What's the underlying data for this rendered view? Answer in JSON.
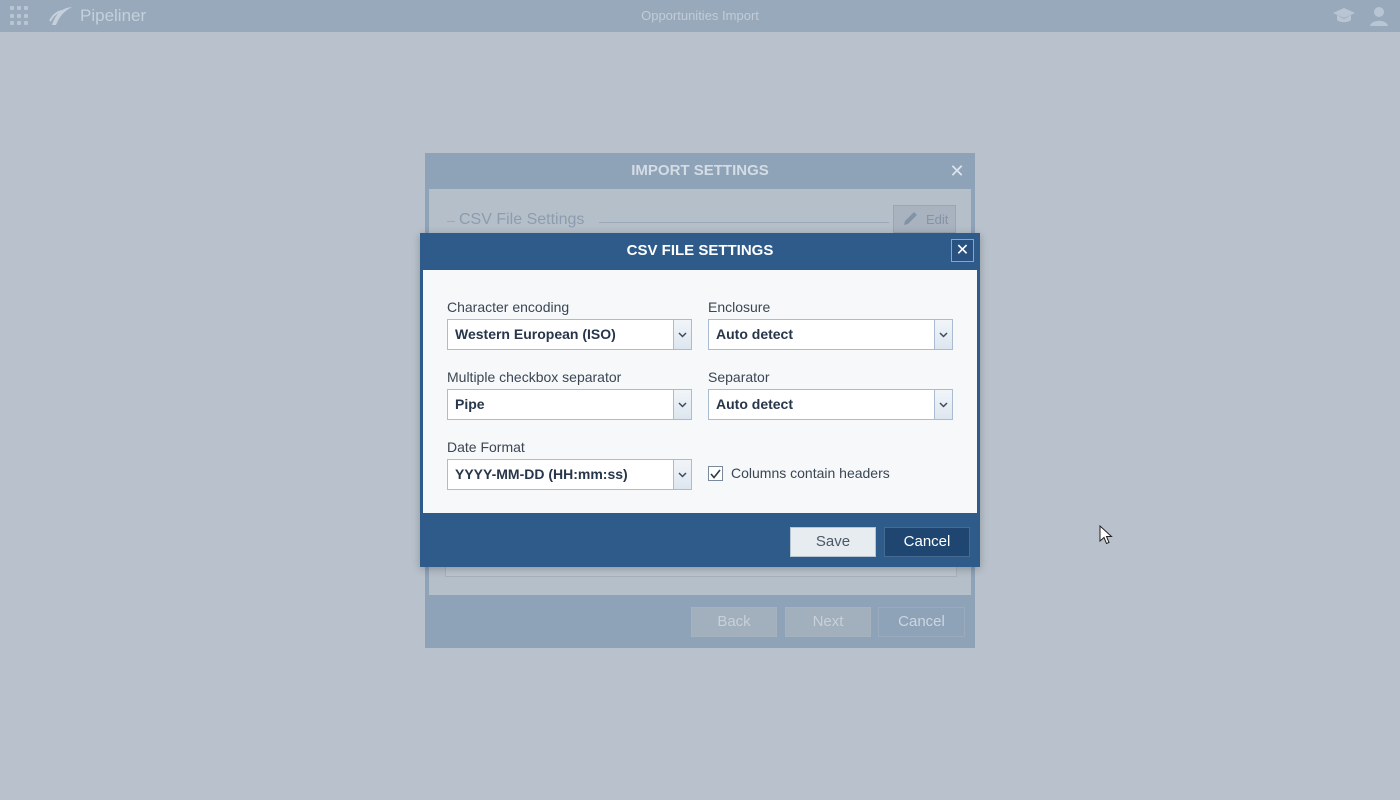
{
  "topbar": {
    "brand": "Pipeliner",
    "title": "Opportunities Import"
  },
  "background_dialog": {
    "title": "IMPORT SETTINGS",
    "close_glyph": "✕",
    "section_title": "CSV File Settings",
    "edit_label": "Edit",
    "buttons": {
      "back": "Back",
      "next": "Next",
      "cancel": "Cancel"
    }
  },
  "csv_dialog": {
    "title": "CSV FILE SETTINGS",
    "close_glyph": "✕",
    "fields": {
      "character_encoding": {
        "label": "Character encoding",
        "value": "Western European (ISO)"
      },
      "enclosure": {
        "label": "Enclosure",
        "value": "Auto detect"
      },
      "multiple_checkbox_separator": {
        "label": "Multiple checkbox separator",
        "value": "Pipe"
      },
      "separator": {
        "label": "Separator",
        "value": "Auto detect"
      },
      "date_format": {
        "label": "Date Format",
        "value": "YYYY-MM-DD (HH:mm:ss)"
      }
    },
    "columns_contain_headers": {
      "label": "Columns contain headers",
      "checked": true
    },
    "buttons": {
      "save": "Save",
      "cancel": "Cancel"
    }
  },
  "colors": {
    "dialog_header": "#2f5b8a",
    "topbar": "#98a9bc",
    "overlay_background": "#b9c2cc"
  },
  "icons": [
    "apps-grid-icon",
    "pipeliner-logo-icon",
    "graduation-cap-icon",
    "user-icon",
    "close-icon",
    "pencil-icon",
    "chevron-down-icon",
    "checkmark-icon",
    "mouse-cursor-icon"
  ]
}
